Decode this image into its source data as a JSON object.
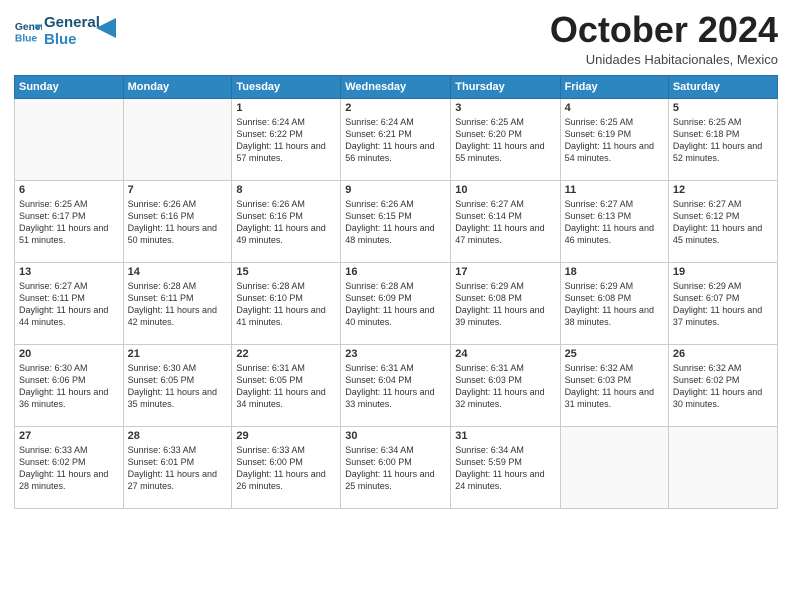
{
  "logo": {
    "line1": "General",
    "line2": "Blue"
  },
  "title": "October 2024",
  "subtitle": "Unidades Habitacionales, Mexico",
  "days_header": [
    "Sunday",
    "Monday",
    "Tuesday",
    "Wednesday",
    "Thursday",
    "Friday",
    "Saturday"
  ],
  "weeks": [
    [
      {
        "day": "",
        "info": ""
      },
      {
        "day": "",
        "info": ""
      },
      {
        "day": "1",
        "info": "Sunrise: 6:24 AM\nSunset: 6:22 PM\nDaylight: 11 hours and 57 minutes."
      },
      {
        "day": "2",
        "info": "Sunrise: 6:24 AM\nSunset: 6:21 PM\nDaylight: 11 hours and 56 minutes."
      },
      {
        "day": "3",
        "info": "Sunrise: 6:25 AM\nSunset: 6:20 PM\nDaylight: 11 hours and 55 minutes."
      },
      {
        "day": "4",
        "info": "Sunrise: 6:25 AM\nSunset: 6:19 PM\nDaylight: 11 hours and 54 minutes."
      },
      {
        "day": "5",
        "info": "Sunrise: 6:25 AM\nSunset: 6:18 PM\nDaylight: 11 hours and 52 minutes."
      }
    ],
    [
      {
        "day": "6",
        "info": "Sunrise: 6:25 AM\nSunset: 6:17 PM\nDaylight: 11 hours and 51 minutes."
      },
      {
        "day": "7",
        "info": "Sunrise: 6:26 AM\nSunset: 6:16 PM\nDaylight: 11 hours and 50 minutes."
      },
      {
        "day": "8",
        "info": "Sunrise: 6:26 AM\nSunset: 6:16 PM\nDaylight: 11 hours and 49 minutes."
      },
      {
        "day": "9",
        "info": "Sunrise: 6:26 AM\nSunset: 6:15 PM\nDaylight: 11 hours and 48 minutes."
      },
      {
        "day": "10",
        "info": "Sunrise: 6:27 AM\nSunset: 6:14 PM\nDaylight: 11 hours and 47 minutes."
      },
      {
        "day": "11",
        "info": "Sunrise: 6:27 AM\nSunset: 6:13 PM\nDaylight: 11 hours and 46 minutes."
      },
      {
        "day": "12",
        "info": "Sunrise: 6:27 AM\nSunset: 6:12 PM\nDaylight: 11 hours and 45 minutes."
      }
    ],
    [
      {
        "day": "13",
        "info": "Sunrise: 6:27 AM\nSunset: 6:11 PM\nDaylight: 11 hours and 44 minutes."
      },
      {
        "day": "14",
        "info": "Sunrise: 6:28 AM\nSunset: 6:11 PM\nDaylight: 11 hours and 42 minutes."
      },
      {
        "day": "15",
        "info": "Sunrise: 6:28 AM\nSunset: 6:10 PM\nDaylight: 11 hours and 41 minutes."
      },
      {
        "day": "16",
        "info": "Sunrise: 6:28 AM\nSunset: 6:09 PM\nDaylight: 11 hours and 40 minutes."
      },
      {
        "day": "17",
        "info": "Sunrise: 6:29 AM\nSunset: 6:08 PM\nDaylight: 11 hours and 39 minutes."
      },
      {
        "day": "18",
        "info": "Sunrise: 6:29 AM\nSunset: 6:08 PM\nDaylight: 11 hours and 38 minutes."
      },
      {
        "day": "19",
        "info": "Sunrise: 6:29 AM\nSunset: 6:07 PM\nDaylight: 11 hours and 37 minutes."
      }
    ],
    [
      {
        "day": "20",
        "info": "Sunrise: 6:30 AM\nSunset: 6:06 PM\nDaylight: 11 hours and 36 minutes."
      },
      {
        "day": "21",
        "info": "Sunrise: 6:30 AM\nSunset: 6:05 PM\nDaylight: 11 hours and 35 minutes."
      },
      {
        "day": "22",
        "info": "Sunrise: 6:31 AM\nSunset: 6:05 PM\nDaylight: 11 hours and 34 minutes."
      },
      {
        "day": "23",
        "info": "Sunrise: 6:31 AM\nSunset: 6:04 PM\nDaylight: 11 hours and 33 minutes."
      },
      {
        "day": "24",
        "info": "Sunrise: 6:31 AM\nSunset: 6:03 PM\nDaylight: 11 hours and 32 minutes."
      },
      {
        "day": "25",
        "info": "Sunrise: 6:32 AM\nSunset: 6:03 PM\nDaylight: 11 hours and 31 minutes."
      },
      {
        "day": "26",
        "info": "Sunrise: 6:32 AM\nSunset: 6:02 PM\nDaylight: 11 hours and 30 minutes."
      }
    ],
    [
      {
        "day": "27",
        "info": "Sunrise: 6:33 AM\nSunset: 6:02 PM\nDaylight: 11 hours and 28 minutes."
      },
      {
        "day": "28",
        "info": "Sunrise: 6:33 AM\nSunset: 6:01 PM\nDaylight: 11 hours and 27 minutes."
      },
      {
        "day": "29",
        "info": "Sunrise: 6:33 AM\nSunset: 6:00 PM\nDaylight: 11 hours and 26 minutes."
      },
      {
        "day": "30",
        "info": "Sunrise: 6:34 AM\nSunset: 6:00 PM\nDaylight: 11 hours and 25 minutes."
      },
      {
        "day": "31",
        "info": "Sunrise: 6:34 AM\nSunset: 5:59 PM\nDaylight: 11 hours and 24 minutes."
      },
      {
        "day": "",
        "info": ""
      },
      {
        "day": "",
        "info": ""
      }
    ]
  ]
}
